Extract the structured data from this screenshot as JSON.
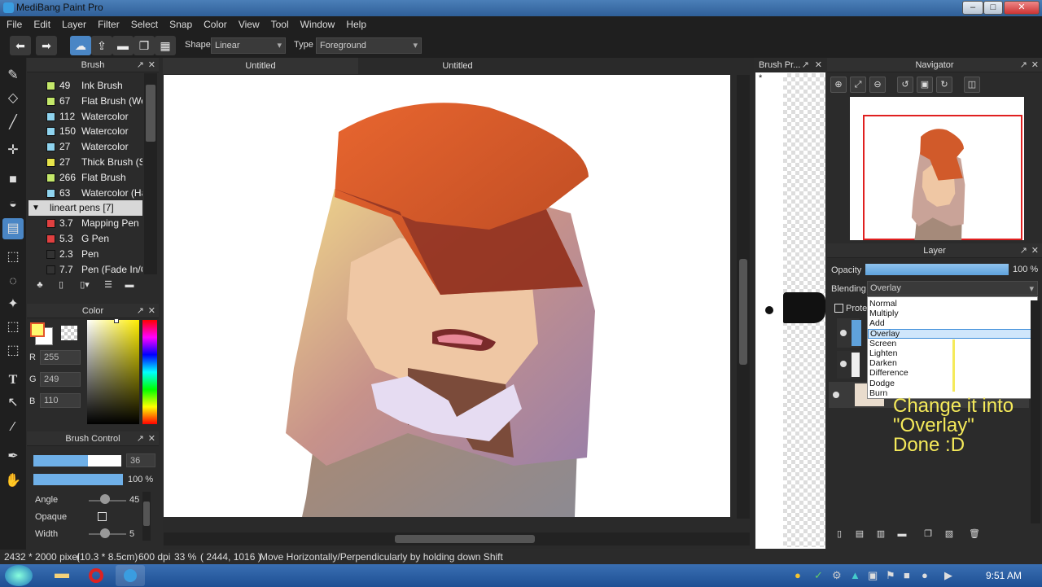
{
  "window": {
    "title": "MediBang Paint Pro",
    "min": "–",
    "max": "□",
    "close": "✕"
  },
  "menu": [
    "File",
    "Edit",
    "Layer",
    "Filter",
    "Select",
    "Snap",
    "Color",
    "View",
    "Tool",
    "Window",
    "Help"
  ],
  "toolbar": {
    "shape_label": "Shape",
    "shape_value": "Linear",
    "type_label": "Type",
    "type_value": "Foreground"
  },
  "brush_panel": {
    "title": "Brush",
    "items": [
      {
        "size": "49",
        "name": "Ink Brush",
        "color": "#c4e86a"
      },
      {
        "size": "67",
        "name": "Flat Brush (We",
        "color": "#c4e86a"
      },
      {
        "size": "112",
        "name": "Watercolor",
        "color": "#8fd4ef"
      },
      {
        "size": "150",
        "name": "Watercolor",
        "color": "#8fd4ef"
      },
      {
        "size": "27",
        "name": "Watercolor",
        "color": "#8fd4ef"
      },
      {
        "size": "27",
        "name": "Thick Brush (S",
        "color": "#e6e34a"
      },
      {
        "size": "266",
        "name": "Flat Brush",
        "color": "#c4e86a"
      },
      {
        "size": "63",
        "name": "Watercolor (Ha",
        "color": "#8fd4ef"
      }
    ],
    "group": "lineart pens [7]",
    "group_items": [
      {
        "size": "3.7",
        "name": "Mapping Pen",
        "color": "#e04040"
      },
      {
        "size": "5.3",
        "name": "G Pen",
        "color": "#e04040"
      },
      {
        "size": "2.3",
        "name": "Pen",
        "color": "#333333"
      },
      {
        "size": "7.7",
        "name": "Pen (Fade In/C",
        "color": "#333333"
      }
    ]
  },
  "color_panel": {
    "title": "Color",
    "r_label": "R",
    "r": "255",
    "g_label": "G",
    "g": "249",
    "b_label": "B",
    "b": "110",
    "fg": "#fff96e"
  },
  "brush_control": {
    "title": "Brush Control",
    "size": "36",
    "opacity": "100 %",
    "angle_label": "Angle",
    "angle": "45",
    "opaque_label": "Opaque",
    "width_label": "Width",
    "width": "5",
    "size_fill": 0.62,
    "opacity_fill": 1.0
  },
  "tabs": [
    "Untitled",
    "Untitled"
  ],
  "brush_preview": {
    "title": "Brush Pr...",
    "star": "*"
  },
  "navigator": {
    "title": "Navigator"
  },
  "layer_panel": {
    "title": "Layer",
    "opacity_label": "Opacity",
    "opacity": "100 %",
    "blending_label": "Blending",
    "blending_value": "Overlay",
    "protect_label": "Prote",
    "options": [
      "Normal",
      "Multiply",
      "Add",
      "Overlay",
      "Screen",
      "Lighten",
      "Darken",
      "Difference",
      "Dodge",
      "Burn"
    ],
    "selected": "Overlay",
    "annotation": [
      "Change it into",
      "\"Overlay\"",
      "Done :D"
    ]
  },
  "status": {
    "pixels": "2432 * 2000 pixel",
    "cm": "(10.3 * 8.5cm)",
    "dpi": "600 dpi",
    "zoom": "33 %",
    "coords": "( 2444, 1016 )",
    "hint": "Move Horizontally/Perpendicularly by holding down Shift"
  },
  "taskbar": {
    "time": "9:51 AM"
  }
}
